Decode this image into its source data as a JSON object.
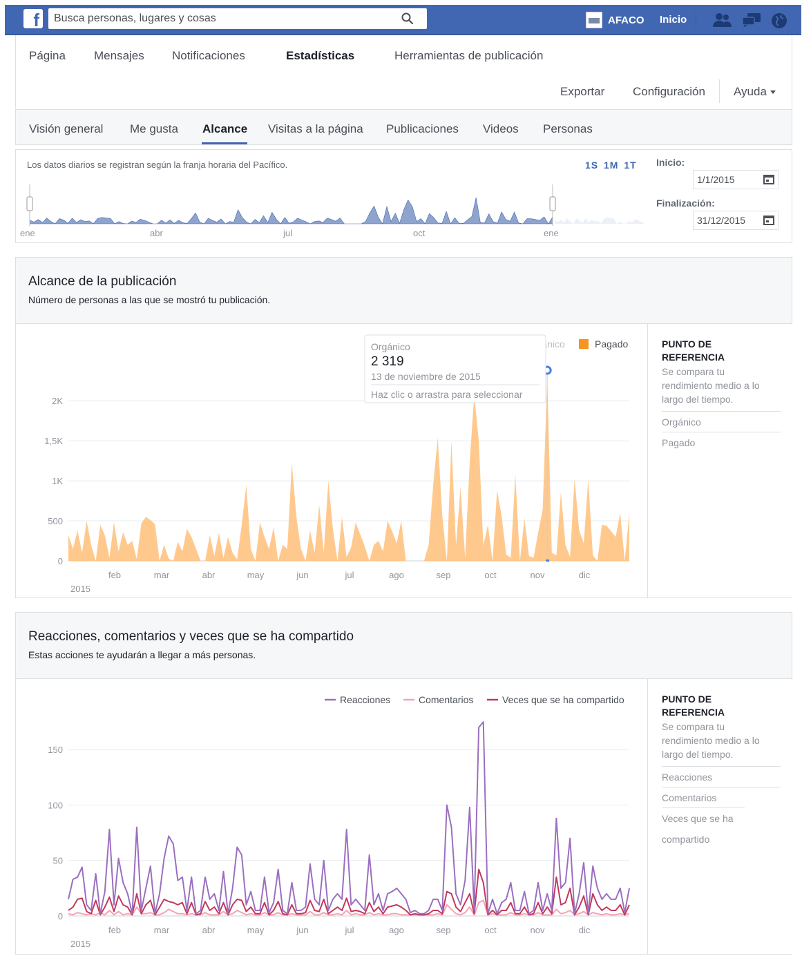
{
  "topbar": {
    "search_placeholder": "Busca personas, lugares y cosas",
    "page_name": "AFACO",
    "home_label": "Inicio"
  },
  "page_nav": {
    "items": [
      "Página",
      "Mensajes",
      "Notificaciones",
      "Estadísticas",
      "Herramientas de publicación"
    ],
    "active": "Estadísticas",
    "export_label": "Exportar",
    "settings_label": "Configuración",
    "help_label": "Ayuda"
  },
  "tabs": {
    "items": [
      "Visión general",
      "Me gusta",
      "Alcance",
      "Visitas a la página",
      "Publicaciones",
      "Videos",
      "Personas"
    ],
    "active": "Alcance"
  },
  "range": {
    "note": "Los datos diarios se registran según la franja horaria del Pacífico.",
    "zoom": "1S 1M 1T",
    "start_label": "Inicio:",
    "start_value": "1/1/2015",
    "end_label": "Finalización:",
    "end_value": "31/12/2015",
    "axis_labels": [
      "ene",
      "abr",
      "jul",
      "oct",
      "ene"
    ]
  },
  "reach": {
    "title": "Alcance de la publicación",
    "subtitle": "Número de personas a las que se mostró tu publicación.",
    "tooltip": {
      "series": "Orgánico",
      "value": "2 319",
      "date": "13 de noviembre de 2015",
      "hint": "Haz clic o arrastra para seleccionar"
    },
    "benchmark": {
      "title": "PUNTO DE REFERENCIA",
      "desc": "Se compara tu rendimiento medio a lo largo del tiempo.",
      "items": [
        "Orgánico",
        "Pagado"
      ]
    }
  },
  "engagement": {
    "title": "Reacciones, comentarios y veces que se ha compartido",
    "subtitle": "Estas acciones te ayudarán a llegar a más personas.",
    "benchmark": {
      "title": "PUNTO DE REFERENCIA",
      "desc": "Se compara tu rendimiento medio a lo largo del tiempo.",
      "items": [
        "Reacciones",
        "Comentarios",
        "Veces que se ha compartido"
      ]
    }
  },
  "colors": {
    "brand": "#4267b2",
    "organic": "#ffc07a",
    "paid": "#f7931e",
    "reactions": "#9b6fc0",
    "comments": "#f2a3b4",
    "shares": "#c0395c"
  },
  "chart_data": [
    {
      "type": "area",
      "xlabel": "2015",
      "x_ticks": [
        "feb",
        "mar",
        "abr",
        "may",
        "jun",
        "jul",
        "ago",
        "sep",
        "oct",
        "nov",
        "dic"
      ],
      "y_ticks": [
        "0",
        "500",
        "1K",
        "1,5K",
        "2K"
      ],
      "ylim": [
        0,
        2000
      ],
      "legend_position": "top-right",
      "series": [
        {
          "name": "Orgánico",
          "color": "#ffc07a",
          "values": [
            320,
            150,
            380,
            100,
            500,
            200,
            0,
            450,
            320,
            40,
            480,
            120,
            360,
            200,
            250,
            20,
            470,
            550,
            510,
            460,
            0,
            200,
            30,
            0,
            240,
            120,
            400,
            300,
            150,
            0,
            0,
            320,
            60,
            350,
            40,
            300,
            100,
            20,
            450,
            950,
            150,
            0,
            480,
            300,
            150,
            420,
            0,
            200,
            150,
            1220,
            550,
            150,
            0,
            380,
            100,
            700,
            110,
            1000,
            400,
            0,
            550,
            50,
            170,
            480,
            330,
            180,
            0,
            200,
            250,
            120,
            500,
            370,
            220,
            500,
            0,
            0,
            0,
            0,
            0,
            200,
            950,
            1540,
            560,
            0,
            1500,
            200,
            920,
            40,
            1230,
            2070,
            1500,
            190,
            450,
            0,
            880,
            560,
            80,
            40,
            1080,
            0,
            530,
            60,
            40,
            350,
            640,
            2280,
            100,
            70,
            860,
            200,
            50,
            1030,
            380,
            220,
            1020,
            70,
            0,
            450,
            440,
            370,
            300,
            600,
            0,
            600
          ]
        },
        {
          "name": "Pagado",
          "color": "#f7931e",
          "values": []
        }
      ]
    },
    {
      "type": "line",
      "xlabel": "2015",
      "x_ticks": [
        "feb",
        "mar",
        "abr",
        "may",
        "jun",
        "jul",
        "ago",
        "sep",
        "oct",
        "nov",
        "dic"
      ],
      "y_ticks": [
        "0",
        "50",
        "100",
        "150"
      ],
      "ylim": [
        0,
        180
      ],
      "legend_position": "top-right",
      "series": [
        {
          "name": "Reacciones",
          "color": "#9b6fc0",
          "values": [
            15,
            33,
            35,
            44,
            10,
            5,
            38,
            2,
            22,
            78,
            10,
            52,
            30,
            20,
            2,
            80,
            5,
            25,
            45,
            2,
            20,
            52,
            72,
            65,
            32,
            35,
            5,
            35,
            2,
            5,
            35,
            15,
            20,
            5,
            40,
            2,
            25,
            62,
            55,
            10,
            22,
            5,
            5,
            35,
            3,
            12,
            42,
            5,
            2,
            30,
            5,
            5,
            8,
            47,
            15,
            10,
            50,
            5,
            15,
            20,
            15,
            78,
            10,
            15,
            10,
            5,
            55,
            10,
            20,
            5,
            20,
            22,
            25,
            20,
            15,
            3,
            5,
            2,
            2,
            5,
            15,
            15,
            5,
            100,
            80,
            20,
            10,
            32,
            98,
            5,
            170,
            175,
            2,
            15,
            2,
            12,
            15,
            30,
            5,
            5,
            22,
            2,
            5,
            30,
            5,
            20,
            5,
            88,
            25,
            30,
            70,
            2,
            20,
            48,
            2,
            45,
            25,
            15,
            20,
            15,
            15,
            25,
            3,
            25
          ]
        },
        {
          "name": "Comentarios",
          "color": "#f2a3b4",
          "values": [
            2,
            1,
            3,
            2,
            1,
            2,
            1,
            3,
            1,
            5,
            1,
            4,
            1,
            2,
            1,
            8,
            2,
            2,
            3,
            1,
            1,
            3,
            6,
            4,
            2,
            2,
            1,
            2,
            1,
            1,
            3,
            1,
            1,
            1,
            4,
            1,
            2,
            5,
            3,
            1,
            2,
            1,
            1,
            3,
            1,
            1,
            3,
            1,
            1,
            2,
            1,
            1,
            1,
            4,
            1,
            1,
            3,
            1,
            1,
            2,
            1,
            5,
            1,
            2,
            1,
            1,
            3,
            1,
            2,
            1,
            1,
            2,
            2,
            1,
            1,
            1,
            1,
            1,
            1,
            1,
            1,
            2,
            1,
            10,
            6,
            2,
            1,
            3,
            8,
            1,
            12,
            14,
            1,
            2,
            1,
            1,
            1,
            3,
            1,
            1,
            2,
            1,
            1,
            3,
            1,
            1,
            1,
            6,
            2,
            3,
            5,
            1,
            2,
            4,
            1,
            3,
            2,
            1,
            2,
            1,
            1,
            2,
            1,
            2
          ]
        },
        {
          "name": "Veces que se ha compartido",
          "color": "#c0395c",
          "values": [
            5,
            8,
            15,
            16,
            4,
            2,
            14,
            1,
            8,
            17,
            4,
            18,
            10,
            8,
            1,
            20,
            2,
            10,
            14,
            1,
            8,
            15,
            13,
            12,
            10,
            12,
            2,
            12,
            1,
            2,
            13,
            5,
            8,
            2,
            12,
            1,
            10,
            15,
            14,
            4,
            8,
            2,
            2,
            12,
            1,
            5,
            13,
            2,
            1,
            10,
            2,
            2,
            3,
            14,
            5,
            4,
            15,
            2,
            5,
            8,
            5,
            16,
            4,
            5,
            4,
            2,
            12,
            4,
            8,
            2,
            8,
            9,
            10,
            8,
            5,
            1,
            2,
            1,
            1,
            2,
            5,
            5,
            2,
            22,
            20,
            8,
            4,
            12,
            20,
            2,
            42,
            30,
            1,
            5,
            1,
            5,
            5,
            12,
            2,
            2,
            8,
            1,
            2,
            12,
            2,
            8,
            2,
            35,
            10,
            12,
            25,
            1,
            8,
            18,
            1,
            20,
            10,
            5,
            8,
            5,
            5,
            10,
            1,
            10
          ]
        }
      ]
    }
  ]
}
